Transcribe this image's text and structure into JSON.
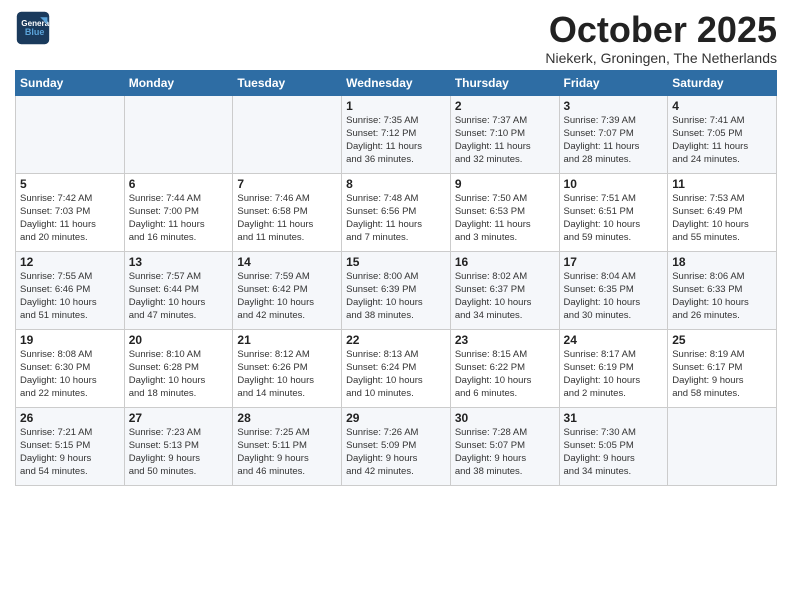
{
  "header": {
    "logo_line1": "General",
    "logo_line2": "Blue",
    "month": "October 2025",
    "location": "Niekerk, Groningen, The Netherlands"
  },
  "days_of_week": [
    "Sunday",
    "Monday",
    "Tuesday",
    "Wednesday",
    "Thursday",
    "Friday",
    "Saturday"
  ],
  "weeks": [
    [
      {
        "day": "",
        "info": ""
      },
      {
        "day": "",
        "info": ""
      },
      {
        "day": "",
        "info": ""
      },
      {
        "day": "1",
        "info": "Sunrise: 7:35 AM\nSunset: 7:12 PM\nDaylight: 11 hours\nand 36 minutes."
      },
      {
        "day": "2",
        "info": "Sunrise: 7:37 AM\nSunset: 7:10 PM\nDaylight: 11 hours\nand 32 minutes."
      },
      {
        "day": "3",
        "info": "Sunrise: 7:39 AM\nSunset: 7:07 PM\nDaylight: 11 hours\nand 28 minutes."
      },
      {
        "day": "4",
        "info": "Sunrise: 7:41 AM\nSunset: 7:05 PM\nDaylight: 11 hours\nand 24 minutes."
      }
    ],
    [
      {
        "day": "5",
        "info": "Sunrise: 7:42 AM\nSunset: 7:03 PM\nDaylight: 11 hours\nand 20 minutes."
      },
      {
        "day": "6",
        "info": "Sunrise: 7:44 AM\nSunset: 7:00 PM\nDaylight: 11 hours\nand 16 minutes."
      },
      {
        "day": "7",
        "info": "Sunrise: 7:46 AM\nSunset: 6:58 PM\nDaylight: 11 hours\nand 11 minutes."
      },
      {
        "day": "8",
        "info": "Sunrise: 7:48 AM\nSunset: 6:56 PM\nDaylight: 11 hours\nand 7 minutes."
      },
      {
        "day": "9",
        "info": "Sunrise: 7:50 AM\nSunset: 6:53 PM\nDaylight: 11 hours\nand 3 minutes."
      },
      {
        "day": "10",
        "info": "Sunrise: 7:51 AM\nSunset: 6:51 PM\nDaylight: 10 hours\nand 59 minutes."
      },
      {
        "day": "11",
        "info": "Sunrise: 7:53 AM\nSunset: 6:49 PM\nDaylight: 10 hours\nand 55 minutes."
      }
    ],
    [
      {
        "day": "12",
        "info": "Sunrise: 7:55 AM\nSunset: 6:46 PM\nDaylight: 10 hours\nand 51 minutes."
      },
      {
        "day": "13",
        "info": "Sunrise: 7:57 AM\nSunset: 6:44 PM\nDaylight: 10 hours\nand 47 minutes."
      },
      {
        "day": "14",
        "info": "Sunrise: 7:59 AM\nSunset: 6:42 PM\nDaylight: 10 hours\nand 42 minutes."
      },
      {
        "day": "15",
        "info": "Sunrise: 8:00 AM\nSunset: 6:39 PM\nDaylight: 10 hours\nand 38 minutes."
      },
      {
        "day": "16",
        "info": "Sunrise: 8:02 AM\nSunset: 6:37 PM\nDaylight: 10 hours\nand 34 minutes."
      },
      {
        "day": "17",
        "info": "Sunrise: 8:04 AM\nSunset: 6:35 PM\nDaylight: 10 hours\nand 30 minutes."
      },
      {
        "day": "18",
        "info": "Sunrise: 8:06 AM\nSunset: 6:33 PM\nDaylight: 10 hours\nand 26 minutes."
      }
    ],
    [
      {
        "day": "19",
        "info": "Sunrise: 8:08 AM\nSunset: 6:30 PM\nDaylight: 10 hours\nand 22 minutes."
      },
      {
        "day": "20",
        "info": "Sunrise: 8:10 AM\nSunset: 6:28 PM\nDaylight: 10 hours\nand 18 minutes."
      },
      {
        "day": "21",
        "info": "Sunrise: 8:12 AM\nSunset: 6:26 PM\nDaylight: 10 hours\nand 14 minutes."
      },
      {
        "day": "22",
        "info": "Sunrise: 8:13 AM\nSunset: 6:24 PM\nDaylight: 10 hours\nand 10 minutes."
      },
      {
        "day": "23",
        "info": "Sunrise: 8:15 AM\nSunset: 6:22 PM\nDaylight: 10 hours\nand 6 minutes."
      },
      {
        "day": "24",
        "info": "Sunrise: 8:17 AM\nSunset: 6:19 PM\nDaylight: 10 hours\nand 2 minutes."
      },
      {
        "day": "25",
        "info": "Sunrise: 8:19 AM\nSunset: 6:17 PM\nDaylight: 9 hours\nand 58 minutes."
      }
    ],
    [
      {
        "day": "26",
        "info": "Sunrise: 7:21 AM\nSunset: 5:15 PM\nDaylight: 9 hours\nand 54 minutes."
      },
      {
        "day": "27",
        "info": "Sunrise: 7:23 AM\nSunset: 5:13 PM\nDaylight: 9 hours\nand 50 minutes."
      },
      {
        "day": "28",
        "info": "Sunrise: 7:25 AM\nSunset: 5:11 PM\nDaylight: 9 hours\nand 46 minutes."
      },
      {
        "day": "29",
        "info": "Sunrise: 7:26 AM\nSunset: 5:09 PM\nDaylight: 9 hours\nand 42 minutes."
      },
      {
        "day": "30",
        "info": "Sunrise: 7:28 AM\nSunset: 5:07 PM\nDaylight: 9 hours\nand 38 minutes."
      },
      {
        "day": "31",
        "info": "Sunrise: 7:30 AM\nSunset: 5:05 PM\nDaylight: 9 hours\nand 34 minutes."
      },
      {
        "day": "",
        "info": ""
      }
    ]
  ]
}
